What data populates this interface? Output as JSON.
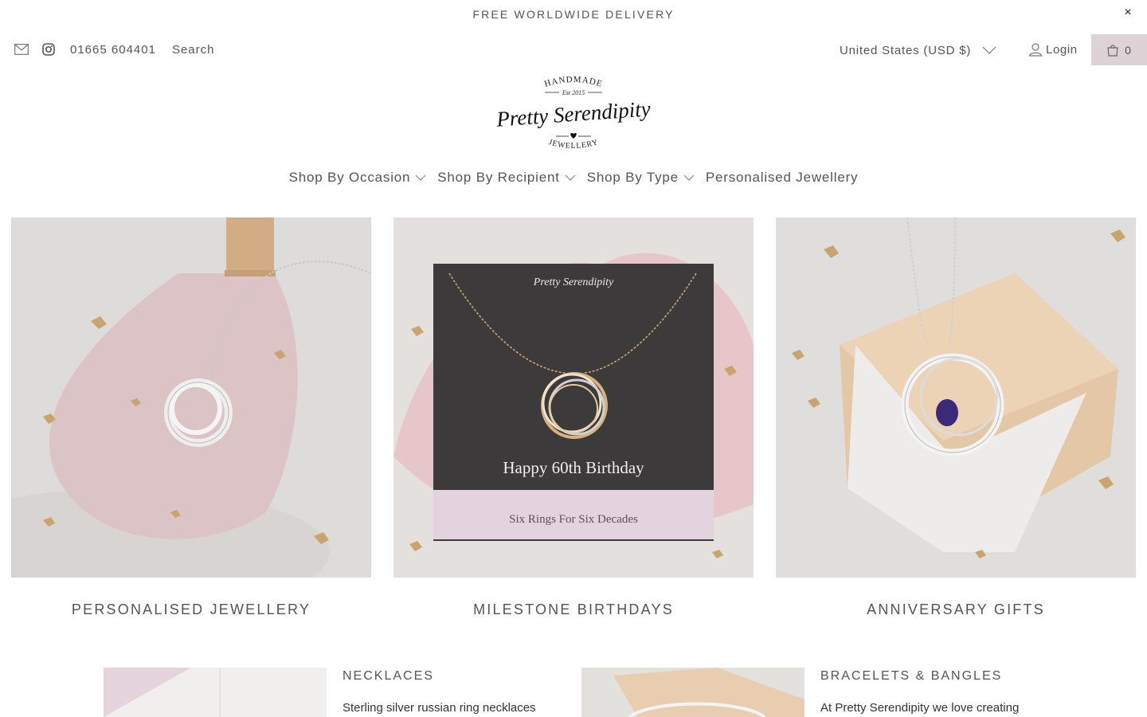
{
  "announcement": {
    "text": "FREE WORLDWIDE DELIVERY",
    "close_icon": "×"
  },
  "header": {
    "phone": "01665 604401",
    "search_label": "Search",
    "currency_label": "United States (USD $)",
    "login_label": "Login",
    "cart_count": "0"
  },
  "logo": {
    "top_text": "HANDMADE",
    "est_text": "Est 2015",
    "brand": "Pretty Serendipity",
    "bottom_text": "JEWELLERY"
  },
  "nav": {
    "items": [
      {
        "label": "Shop By Occasion",
        "has_dropdown": true
      },
      {
        "label": "Shop By Recipient",
        "has_dropdown": true
      },
      {
        "label": "Shop By Type",
        "has_dropdown": true
      },
      {
        "label": "Personalised Jewellery",
        "has_dropdown": false
      }
    ]
  },
  "tiles": [
    {
      "label": "PERSONALISED JEWELLERY"
    },
    {
      "label": "MILESTONE BIRTHDAYS",
      "card_main": "Happy 60th Birthday",
      "card_sub": "Six Rings For Six Decades"
    },
    {
      "label": "ANNIVERSARY GIFTS"
    }
  ],
  "subcategories": [
    {
      "title": "NECKLACES",
      "desc": "Sterling silver russian ring necklaces"
    },
    {
      "title": "BRACELETS & BANGLES",
      "desc": "At Pretty Serendipity we love creating"
    }
  ],
  "colors": {
    "text": "#555555",
    "cart_bg": "#ddd3d6",
    "accent_pink": "#e8d3d8"
  },
  "icons": [
    "close-icon",
    "mail-icon",
    "instagram-icon",
    "chevron-down-icon",
    "user-icon",
    "bag-icon"
  ]
}
